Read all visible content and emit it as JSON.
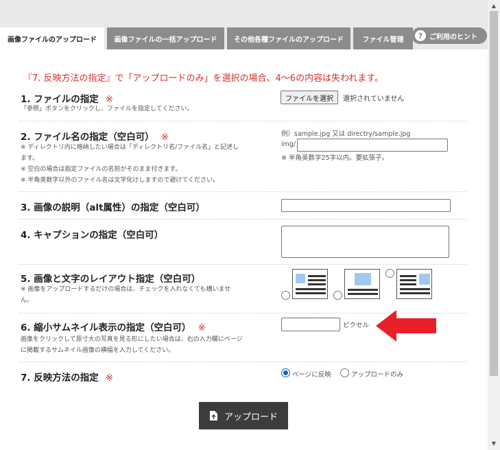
{
  "tabs": [
    {
      "label": "画像ファイルのアップロード",
      "active": true
    },
    {
      "label": "画像ファイルの一括アップロード",
      "active": false
    },
    {
      "label": "その他各種ファイルのアップロード",
      "active": false
    },
    {
      "label": "ファイル管理",
      "active": false
    }
  ],
  "hint": {
    "icon": "?",
    "label": "ご利用のヒント"
  },
  "notice": "『7. 反映方法の指定』で「アップロードのみ」を選択の場合、4〜6の内容は失われます。",
  "sections": {
    "file": {
      "title": "1. ファイルの指定",
      "required": "※",
      "desc": "「参照」ボタンをクリックし、ファイルを指定してください。",
      "button": "ファイルを選択",
      "status": "選択されていません"
    },
    "filename": {
      "title": "2. ファイル名の指定（空白可）",
      "required": "※",
      "desc1": "※ ディレクトリ内に格納したい場合は「ディレクトリ名/ファイル名」と記述し",
      "desc2": "ます。",
      "desc3": "※ 空白の場合は指定ファイルの名前がそのまま付きます。",
      "desc4": "※ 半角英数字以外のファイル名は文字化けしますので避けてください。",
      "example": "例）sample.jpg 又は directry/sample.jpg",
      "prefix": "img/",
      "value": "",
      "note": "※ 半角英数字25字以内。要拡張子。"
    },
    "alt": {
      "title": "3. 画像の説明（alt属性）の指定（空白可）",
      "value": ""
    },
    "caption": {
      "title": "4. キャプションの指定（空白可）",
      "value": ""
    },
    "layout": {
      "title": "5. 画像と文字のレイアウト指定（空白可）",
      "desc1": "※ 画像をアップロードするだけの場合は、チェックを入れなくても構いませ",
      "desc2": "ん。",
      "options": [
        "layout-image-left-icon",
        "layout-image-top-icon",
        "layout-image-right-icon"
      ]
    },
    "thumb": {
      "title": "6. 縮小サムネイル表示の指定（空白可）",
      "required": "※",
      "desc1": "画像をクリックして原寸大の写真を見る形にしたい場合は、右の入力欄にページ",
      "desc2": "に掲載するサムネイル画像の横幅を入力してください。",
      "value": "",
      "unit": "ピクセル"
    },
    "reflect": {
      "title": "7. 反映方法の指定",
      "required": "※",
      "opt1": "ページに反映",
      "opt2": "アップロードのみ",
      "selected": "ページに反映"
    }
  },
  "upload_button": "アップロード",
  "colors": {
    "accent_red": "#d32f2f",
    "arrow_red": "#e8202a",
    "radio_blue": "#1565c0",
    "tab_gray": "#8c8c8c",
    "button_dark": "#3c3c3c",
    "layout_blue": "#9fc9f3"
  }
}
